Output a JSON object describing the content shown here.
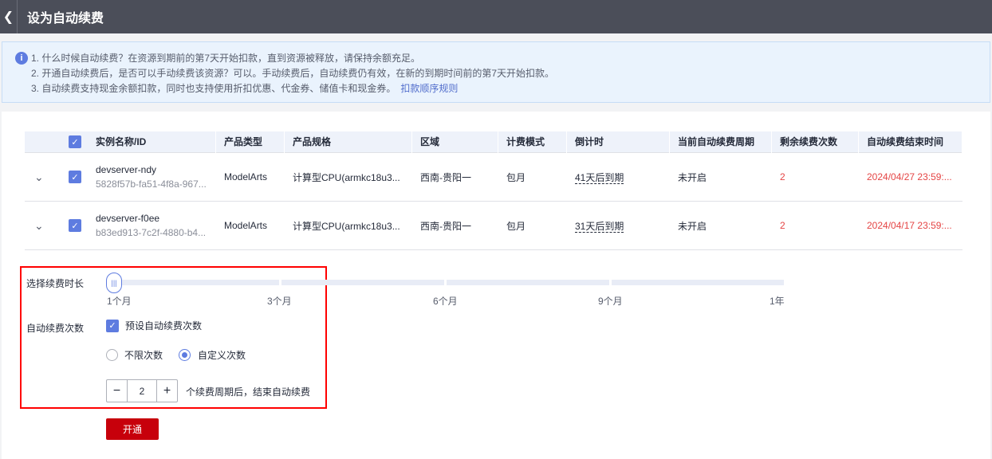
{
  "header": {
    "title": "设为自动续费"
  },
  "info": {
    "lines": [
      "1. 什么时候自动续费？在资源到期前的第7天开始扣款，直到资源被释放，请保持余额充足。",
      "2. 开通自动续费后，是否可以手动续费该资源？可以。手动续费后，自动续费仍有效，在新的到期时间前的第7天开始扣款。",
      "3. 自动续费支持现金余额扣款，同时也支持使用折扣优惠、代金券、储值卡和现金券。"
    ],
    "link": "扣款顺序规则"
  },
  "table": {
    "headers": [
      "实例名称/ID",
      "产品类型",
      "产品规格",
      "区域",
      "计费模式",
      "倒计时",
      "当前自动续费周期",
      "剩余续费次数",
      "自动续费结束时间"
    ],
    "rows": [
      {
        "name": "devserver-ndy",
        "id": "5828f57b-fa51-4f8a-967...",
        "type": "ModelArts",
        "spec": "计算型CPU(armkc18u3...",
        "region": "西南-贵阳一",
        "billing": "包月",
        "countdown": "41天后到期",
        "period": "未开启",
        "remaining": "2",
        "end": "2024/04/27 23:59:..."
      },
      {
        "name": "devserver-f0ee",
        "id": "b83ed913-7c2f-4880-b4...",
        "type": "ModelArts",
        "spec": "计算型CPU(armkc18u3...",
        "region": "西南-贵阳一",
        "billing": "包月",
        "countdown": "31天后到期",
        "period": "未开启",
        "remaining": "2",
        "end": "2024/04/17 23:59:..."
      }
    ]
  },
  "form": {
    "duration_label": "选择续费时长",
    "ticks": [
      "1个月",
      "3个月",
      "6个月",
      "9个月",
      "1年"
    ],
    "selected": "1个月",
    "count_label": "自动续费次数",
    "preset_label": "预设自动续费次数",
    "preset_checked": true,
    "radio_unlimited": "不限次数",
    "radio_custom": "自定义次数",
    "radio_selected": "custom",
    "count_value": "2",
    "count_suffix": "个续费周期后，结束自动续费",
    "submit": "开通"
  }
}
